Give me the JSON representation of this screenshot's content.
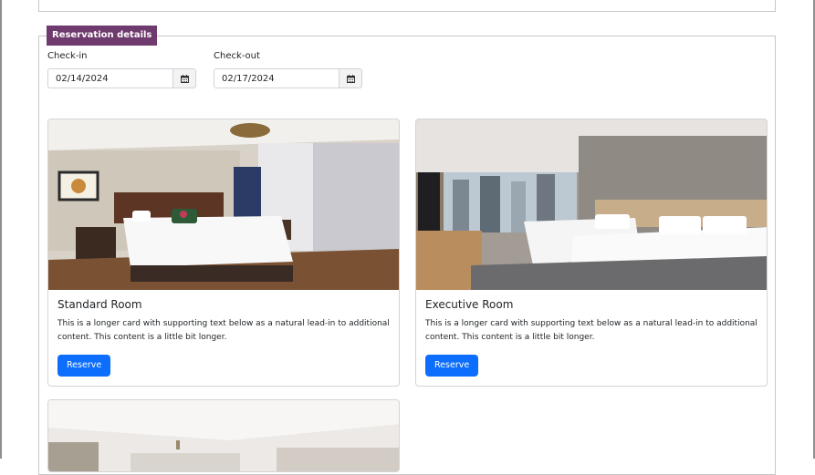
{
  "reservation": {
    "legend": "Reservation details",
    "checkin": {
      "label": "Check-in",
      "value": "02/14/2024"
    },
    "checkout": {
      "label": "Check-out",
      "value": "02/17/2024"
    }
  },
  "rooms": [
    {
      "title": "Standard Room",
      "text": "This is a longer card with supporting text below as a natural lead-in to additional content. This content is a little bit longer.",
      "button": "Reserve"
    },
    {
      "title": "Executive Room",
      "text": "This is a longer card with supporting text below as a natural lead-in to additional content. This content is a little bit longer.",
      "button": "Reserve"
    }
  ],
  "icons": {
    "calendar": "calendar-icon"
  },
  "colors": {
    "legend_bg": "#6f3a6d",
    "button_bg": "#0d6efd"
  }
}
